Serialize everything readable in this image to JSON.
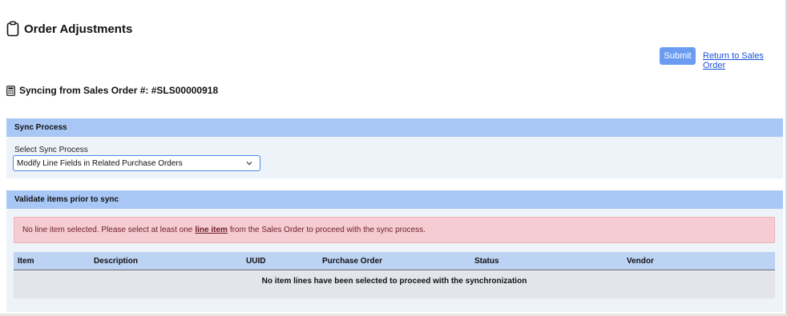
{
  "page": {
    "title": "Order Adjustments",
    "title_icon": "clipboard-icon"
  },
  "actions": {
    "submit_label": "Submit",
    "return_link_label": "Return to Sales Order",
    "submit_color": "#6c9cf2",
    "link_color": "#1a4fd6"
  },
  "sync_source": {
    "icon": "calculator-icon",
    "label": "Syncing from Sales Order #: #SLS00000918"
  },
  "sync_process": {
    "header": "Sync Process",
    "select_label": "Select Sync Process",
    "selected_value": "Modify Line Fields in Related Purchase Orders",
    "header_color": "#a9c7f5"
  },
  "validate": {
    "header": "Validate items prior to sync",
    "alert_prefix": "No line item selected. Please select at least one",
    "alert_strong": "line item",
    "alert_suffix": "from the Sales Order to proceed with the sync process.",
    "alert_color": "#f5ccd1",
    "columns": [
      "Item",
      "Description",
      "UUID",
      "Purchase Order",
      "Status",
      "Vendor"
    ],
    "empty_message": "No item lines have been selected to proceed with the synchronization"
  }
}
